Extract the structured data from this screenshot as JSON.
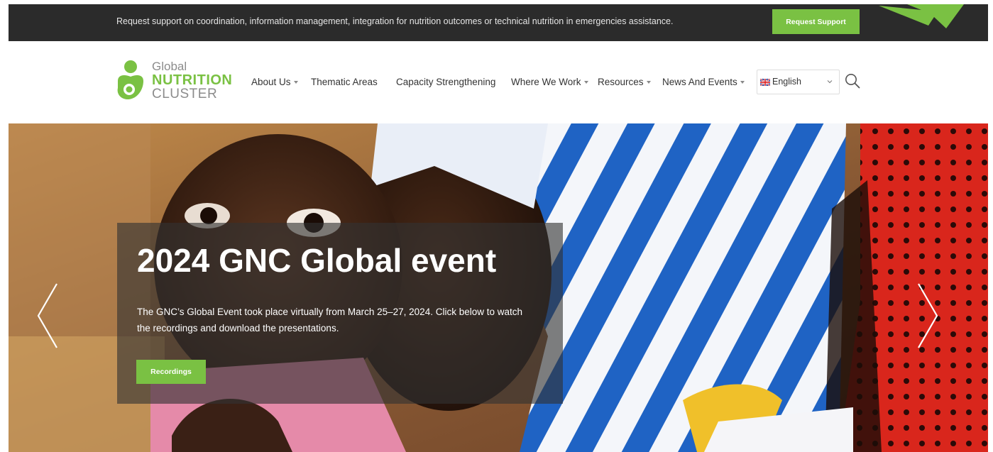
{
  "topbar": {
    "message": "Request support on coordination, information management, integration for nutrition outcomes or technical nutrition in emergencies assistance.",
    "button_label": "Request Support"
  },
  "logo": {
    "line1": "Global",
    "line2": "NUTRITION",
    "line3": "CLUSTER"
  },
  "nav": {
    "items": [
      {
        "label": "About Us",
        "has_dropdown": true
      },
      {
        "label": "Thematic Areas",
        "has_dropdown": false
      },
      {
        "label": "Capacity Strengthening",
        "has_dropdown": false
      },
      {
        "label": "Where We Work",
        "has_dropdown": true
      },
      {
        "label": "Resources",
        "has_dropdown": true
      },
      {
        "label": "News And Events",
        "has_dropdown": true
      }
    ]
  },
  "language": {
    "selected": "English",
    "flag_icon": "uk-flag-icon"
  },
  "hero": {
    "title": "2024 GNC Global event",
    "description": "The GNC’s Global Event took place virtually from March 25–27, 2024. Click below to watch the recordings and download the presentations.",
    "button_label": "Recordings"
  },
  "colors": {
    "accent_green": "#7ac143",
    "topbar_bg": "#2b2b2b",
    "logo_grey": "#8c8c8c"
  }
}
